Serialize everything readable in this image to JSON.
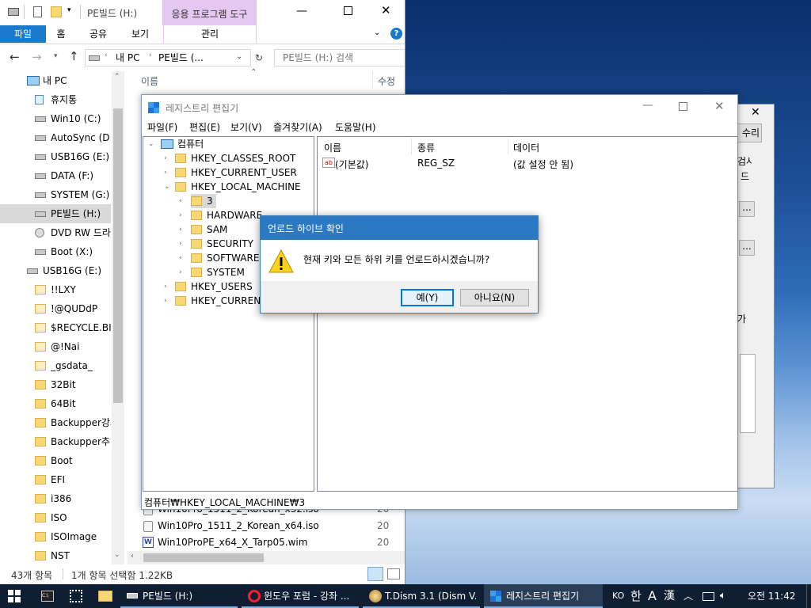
{
  "explorer": {
    "title": "PE빌드 (H:)",
    "contextual_tab_group": "응용 프로그램 도구",
    "ribbon_tabs": [
      "파일",
      "홈",
      "공유",
      "보기",
      "관리"
    ],
    "path": [
      "내 PC",
      "PE빌드 (..."
    ],
    "search_placeholder": "PE빌드 (H:) 검색",
    "column_name": "이름",
    "column_modified": "수정",
    "tree": [
      {
        "label": "내 PC",
        "icon": "pc-icon"
      },
      {
        "label": "휴지통",
        "icon": "recycle-bin-icon"
      },
      {
        "label": "Win10 (C:)",
        "icon": "drive-icon"
      },
      {
        "label": "AutoSync (D:)",
        "icon": "drive-icon"
      },
      {
        "label": "USB16G (E:)",
        "icon": "drive-icon"
      },
      {
        "label": "DATA (F:)",
        "icon": "drive-icon"
      },
      {
        "label": "SYSTEM (G:)",
        "icon": "drive-icon"
      },
      {
        "label": "PE빌드 (H:)",
        "icon": "drive-icon"
      },
      {
        "label": "DVD RW 드라",
        "icon": "dvd-icon"
      },
      {
        "label": "Boot (X:)",
        "icon": "drive-icon"
      },
      {
        "label": "USB16G (E:)",
        "icon": "drive-icon"
      },
      {
        "label": "!!LXY",
        "icon": "folder-icon"
      },
      {
        "label": "!@QUDdP",
        "icon": "folder-icon"
      },
      {
        "label": "$RECYCLE.BIN",
        "icon": "folder-icon"
      },
      {
        "label": "@!Nai",
        "icon": "folder-icon"
      },
      {
        "label": "_gsdata_",
        "icon": "folder-icon"
      },
      {
        "label": "32Bit",
        "icon": "folder-icon"
      },
      {
        "label": "64Bit",
        "icon": "folder-icon"
      },
      {
        "label": "Backupper강좌",
        "icon": "folder-icon"
      },
      {
        "label": "Backupper추기",
        "icon": "folder-icon"
      },
      {
        "label": "Boot",
        "icon": "folder-icon"
      },
      {
        "label": "EFI",
        "icon": "folder-icon"
      },
      {
        "label": "i386",
        "icon": "folder-icon"
      },
      {
        "label": "ISO",
        "icon": "folder-icon"
      },
      {
        "label": "ISOImage",
        "icon": "folder-icon"
      },
      {
        "label": "NST",
        "icon": "folder-icon"
      }
    ],
    "files": [
      {
        "name": "Win10Pro_1511_2_Korean_x32.iso",
        "date": "20"
      },
      {
        "name": "Win10Pro_1511_2_Korean_x64.iso",
        "date": "20"
      },
      {
        "name": "Win10ProPE_x64_X_Tarp05.wim",
        "date": "20"
      }
    ],
    "status_items": "43개 항목",
    "status_selected": "1개 항목 선택함 1.22KB"
  },
  "regedit": {
    "title": "레지스트리 편집기",
    "menu": [
      "파일(F)",
      "편집(E)",
      "보기(V)",
      "즐겨찾기(A)",
      "도움말(H)"
    ],
    "tree_root": "컴퓨터",
    "hives": [
      "HKEY_CLASSES_ROOT",
      "HKEY_CURRENT_USER",
      "HKEY_LOCAL_MACHINE"
    ],
    "hklm_children": [
      "3",
      "HARDWARE",
      "SAM",
      "SECURITY",
      "SOFTWARE",
      "SYSTEM"
    ],
    "hives_after": [
      "HKEY_USERS",
      "HKEY_CURRENT"
    ],
    "columns": {
      "name": "이름",
      "type": "종류",
      "data": "데이터"
    },
    "values": [
      {
        "name": "(기본값)",
        "type": "REG_SZ",
        "data": "(값 설정 안 됨)"
      }
    ],
    "status_path": "컴퓨터₩HKEY_LOCAL_MACHINE₩3"
  },
  "confirm_dialog": {
    "title": "언로드 하이브 확인",
    "message": "현재 키와 모든 하위 키를 언로드하시겠습니까?",
    "yes_label": "예(Y)",
    "no_label": "아니요(N)"
  },
  "back_dialog": {
    "button_label": "수리",
    "text1": "검사",
    "text2": "드",
    "dots1": "...",
    "dots2": "...",
    "text3": "가"
  },
  "taskbar": {
    "items": [
      "PE빌드 (H:)",
      "윈도우 포럼 - 강좌 ...",
      "T.Dism 3.1 (Dism V...",
      "레지스트리 편집기"
    ],
    "ime_lang": "KO",
    "ime_mode": "한",
    "ime_a": "A",
    "ime_hanja": "漢",
    "clock": "오전 11:42"
  },
  "colors": {
    "accent": "#1979ca",
    "contextual": "#e5c7f2",
    "taskbar": "#0f1e33",
    "dialog_title": "#2b79c2"
  }
}
